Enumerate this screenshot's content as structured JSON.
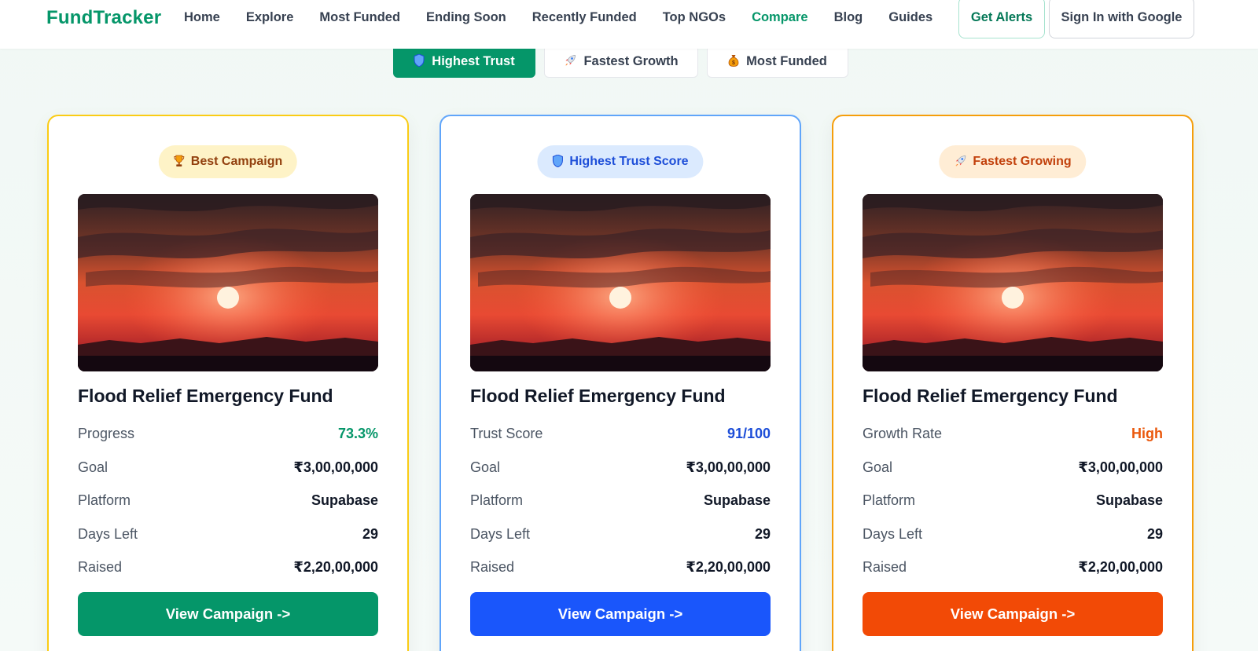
{
  "brand": "FundTracker",
  "nav": {
    "links": [
      {
        "label": "Home"
      },
      {
        "label": "Explore"
      },
      {
        "label": "Most Funded"
      },
      {
        "label": "Ending Soon"
      },
      {
        "label": "Recently Funded"
      },
      {
        "label": "Top NGOs"
      },
      {
        "label": "Compare",
        "active": true
      },
      {
        "label": "Blog"
      },
      {
        "label": "Guides"
      }
    ],
    "alerts_label": "Get Alerts",
    "signin_label": "Sign In with Google"
  },
  "tabs": [
    {
      "icon": "shield-icon",
      "label": "Highest Trust",
      "active": true
    },
    {
      "icon": "rocket-icon",
      "label": "Fastest Growth"
    },
    {
      "icon": "money-bag-icon",
      "label": "Most Funded"
    }
  ],
  "colors": {
    "brand": "#059669",
    "card1_accent": "#facc15",
    "card2_accent": "#60a5fa",
    "card3_accent": "#f59e0b",
    "button_green": "#059669",
    "button_blue": "#1a56fb",
    "button_orange": "#f24a06"
  },
  "cards": [
    {
      "badge_icon": "trophy-icon",
      "badge": "Best Campaign",
      "title": "Flood Relief Emergency Fund",
      "metric_label": "Progress",
      "metric_value": "73.3%",
      "goal_label": "Goal",
      "goal": "₹3,00,00,000",
      "platform_label": "Platform",
      "platform": "Supabase",
      "days_label": "Days Left",
      "days_left": "29",
      "raised_label": "Raised",
      "raised": "₹2,20,00,000",
      "cta": "View Campaign ->"
    },
    {
      "badge_icon": "shield-icon",
      "badge": "Highest Trust Score",
      "title": "Flood Relief Emergency Fund",
      "metric_label": "Trust Score",
      "metric_value": "91/100",
      "goal_label": "Goal",
      "goal": "₹3,00,00,000",
      "platform_label": "Platform",
      "platform": "Supabase",
      "days_label": "Days Left",
      "days_left": "29",
      "raised_label": "Raised",
      "raised": "₹2,20,00,000",
      "cta": "View Campaign ->"
    },
    {
      "badge_icon": "rocket-icon",
      "badge": "Fastest Growing",
      "title": "Flood Relief Emergency Fund",
      "metric_label": "Growth Rate",
      "metric_value": "High",
      "goal_label": "Goal",
      "goal": "₹3,00,00,000",
      "platform_label": "Platform",
      "platform": "Supabase",
      "days_label": "Days Left",
      "days_left": "29",
      "raised_label": "Raised",
      "raised": "₹2,20,00,000",
      "cta": "View Campaign ->"
    }
  ]
}
